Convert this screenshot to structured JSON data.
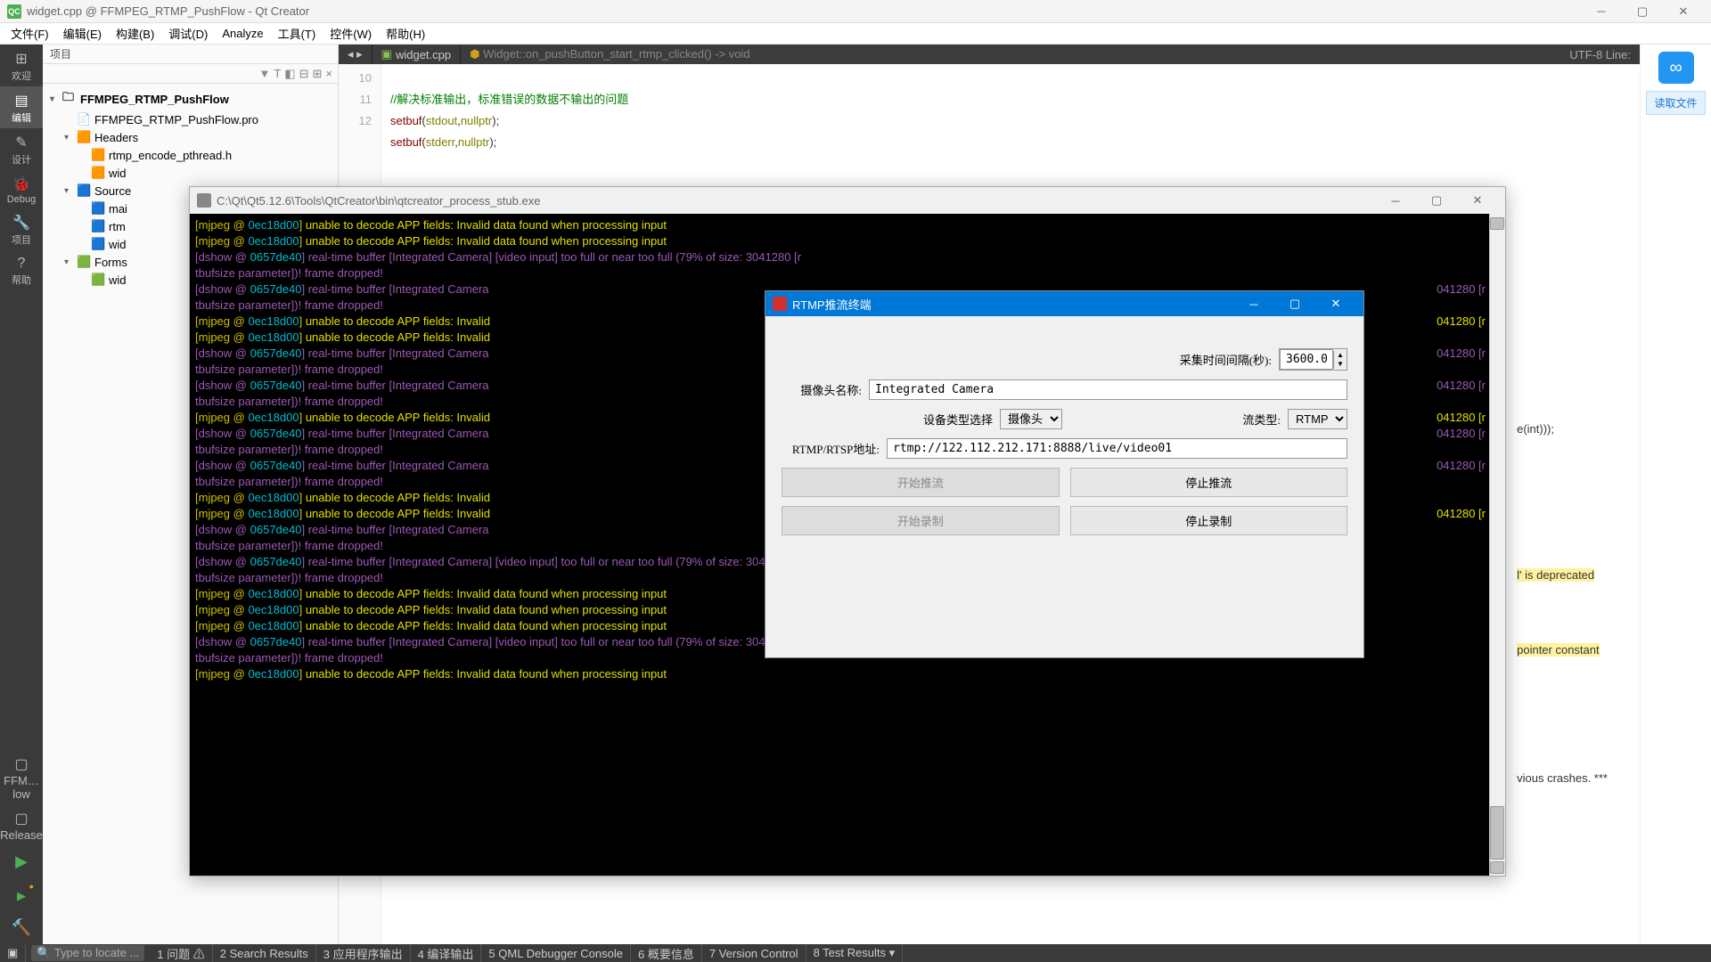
{
  "window": {
    "title": "widget.cpp @ FFMPEG_RTMP_PushFlow - Qt Creator",
    "logo_text": "QC"
  },
  "menu": [
    "文件(F)",
    "编辑(E)",
    "构建(B)",
    "调试(D)",
    "Analyze",
    "工具(T)",
    "控件(W)",
    "帮助(H)"
  ],
  "sidebar": [
    {
      "label": "欢迎",
      "icon": "⊞"
    },
    {
      "label": "编辑",
      "icon": "▤",
      "active": true
    },
    {
      "label": "设计",
      "icon": "✎"
    },
    {
      "label": "Debug",
      "icon": "🐞"
    },
    {
      "label": "项目",
      "icon": "🔧"
    },
    {
      "label": "帮助",
      "icon": "?"
    }
  ],
  "sidebar_bottom": {
    "project": "FFM…low",
    "target": "▢",
    "release": "Release",
    "run": "▶",
    "rundbg": "▶",
    "hammer": "🔨"
  },
  "panel": {
    "header": "项目",
    "toolbar_icons": [
      "▼",
      "T",
      "◧",
      "⊟",
      "⊞",
      "×"
    ],
    "tree": [
      {
        "d": 0,
        "arrow": "▾",
        "icon": "🗀",
        "text": "FFMPEG_RTMP_PushFlow",
        "bold": true
      },
      {
        "d": 1,
        "arrow": "",
        "icon": "📄",
        "text": "FFMPEG_RTMP_PushFlow.pro"
      },
      {
        "d": 1,
        "arrow": "▾",
        "icon": "h",
        "text": "Headers"
      },
      {
        "d": 2,
        "arrow": "",
        "icon": "h",
        "text": "rtmp_encode_pthread.h"
      },
      {
        "d": 2,
        "arrow": "",
        "icon": "h",
        "text": "wid"
      },
      {
        "d": 1,
        "arrow": "▾",
        "icon": "c",
        "text": "Source"
      },
      {
        "d": 2,
        "arrow": "",
        "icon": "c",
        "text": "mai"
      },
      {
        "d": 2,
        "arrow": "",
        "icon": "c",
        "text": "rtm"
      },
      {
        "d": 2,
        "arrow": "",
        "icon": "c",
        "text": "wid"
      },
      {
        "d": 1,
        "arrow": "▾",
        "icon": "ui",
        "text": "Forms"
      },
      {
        "d": 2,
        "arrow": "",
        "icon": "ui",
        "text": "wid"
      }
    ]
  },
  "editor": {
    "tab": "widget.cpp",
    "breadcrumb": "Widget::on_pushButton_start_rtmp_clicked() -> void",
    "encoding": "UTF-8 Line:",
    "gutter": [
      "10",
      "11",
      "12",
      ""
    ],
    "code_comment": "//解决标准输出，标准错误的数据不输出的问题",
    "code_l1_a": "setbuf",
    "code_l1_b": "(",
    "code_l1_c": "stdout",
    "code_l1_d": ",",
    "code_l1_e": "nullptr",
    "code_l1_f": ");",
    "code_l2_a": "setbuf",
    "code_l2_b": "(",
    "code_l2_c": "stderr",
    "code_l2_d": ",",
    "code_l2_e": "nullptr",
    "code_l2_f": ");"
  },
  "bgcode": {
    "l1": "e(int)));",
    "l2": "l' is deprecated",
    "l3": "pointer constant",
    "l4": "vious crashes. ***"
  },
  "right": {
    "cloud": "∞",
    "read": "读取文件"
  },
  "console": {
    "title": "C:\\Qt\\Qt5.12.6\\Tools\\QtCreator\\bin\\qtcreator_process_stub.exe",
    "lines": [
      {
        "t": "m",
        "addr": "0ec18d00",
        "msg": "unable to decode APP fields: Invalid data found when processing input"
      },
      {
        "t": "m",
        "addr": "0ec18d00",
        "msg": "unable to decode APP fields: Invalid data found when processing input"
      },
      {
        "t": "d",
        "addr": "0657de40",
        "msg": "real-time buffer [Integrated Camera] [video input] too full or near too full (79% of size: 3041280 [r",
        "wrap": "tbufsize parameter])! frame dropped!"
      },
      {
        "t": "d",
        "addr": "0657de40",
        "msg": "real-time buffer [Integrated Camera",
        "wrap": "tbufsize parameter])! frame dropped!",
        "tail": "041280 [r"
      },
      {
        "t": "m",
        "addr": "0ec18d00",
        "msg": "unable to decode APP fields: Invalid",
        "tail": "041280 [r"
      },
      {
        "t": "m",
        "addr": "0ec18d00",
        "msg": "unable to decode APP fields: Invalid"
      },
      {
        "t": "d",
        "addr": "0657de40",
        "msg": "real-time buffer [Integrated Camera",
        "wrap": "tbufsize parameter])! frame dropped!",
        "tail": "041280 [r"
      },
      {
        "t": "d",
        "addr": "0657de40",
        "msg": "real-time buffer [Integrated Camera",
        "wrap": "tbufsize parameter])! frame dropped!",
        "tail": "041280 [r"
      },
      {
        "t": "m",
        "addr": "0ec18d00",
        "msg": "unable to decode APP fields: Invalid",
        "tail": "041280 [r"
      },
      {
        "t": "d",
        "addr": "0657de40",
        "msg": "real-time buffer [Integrated Camera",
        "wrap": "tbufsize parameter])! frame dropped!",
        "tail": "041280 [r"
      },
      {
        "t": "d",
        "addr": "0657de40",
        "msg": "real-time buffer [Integrated Camera",
        "wrap": "tbufsize parameter])! frame dropped!",
        "tail": "041280 [r"
      },
      {
        "t": "m",
        "addr": "0ec18d00",
        "msg": "unable to decode APP fields: Invalid"
      },
      {
        "t": "m",
        "addr": "0ec18d00",
        "msg": "unable to decode APP fields: Invalid",
        "tail": "041280 [r"
      },
      {
        "t": "d",
        "addr": "0657de40",
        "msg": "real-time buffer [Integrated Camera",
        "wrap": "tbufsize parameter])! frame dropped!"
      },
      {
        "t": "d",
        "addr": "0657de40",
        "msg": "real-time buffer [Integrated Camera] [video input] too full or near too full (79% of size: 3041280 [r",
        "wrap": "tbufsize parameter])! frame dropped!"
      },
      {
        "t": "m",
        "addr": "0ec18d00",
        "msg": "unable to decode APP fields: Invalid data found when processing input"
      },
      {
        "t": "m",
        "addr": "0ec18d00",
        "msg": "unable to decode APP fields: Invalid data found when processing input"
      },
      {
        "t": "m",
        "addr": "0ec18d00",
        "msg": "unable to decode APP fields: Invalid data found when processing input"
      },
      {
        "t": "d",
        "addr": "0657de40",
        "msg": "real-time buffer [Integrated Camera] [video input] too full or near too full (79% of size: 3041280 [r",
        "wrap": "tbufsize parameter])! frame dropped!"
      },
      {
        "t": "m",
        "addr": "0ec18d00",
        "msg": "unable to decode APP fields: Invalid data found when processing input"
      }
    ]
  },
  "dialog": {
    "title": "RTMP推流终端",
    "interval_label": "采集时间间隔(秒):",
    "interval_value": "3600.00",
    "camera_label": "摄像头名称:",
    "camera_value": "Integrated Camera",
    "devtype_label": "设备类型选择",
    "devtype_value": "摄像头",
    "streamtype_label": "流类型:",
    "streamtype_value": "RTMP",
    "url_label": "RTMP/RTSP地址:",
    "url_value": "rtmp://122.112.212.171:8888/live/video01",
    "btn_start_push": "开始推流",
    "btn_stop_push": "停止推流",
    "btn_start_rec": "开始录制",
    "btn_stop_rec": "停止录制"
  },
  "status": {
    "search_placeholder": "Type to locate ...",
    "items": [
      "1 问题 ⚠",
      "2 Search Results",
      "3 应用程序输出",
      "4 编译输出",
      "5 QML Debugger Console",
      "6 概要信息",
      "7 Version Control",
      "8 Test Results ▾"
    ]
  }
}
